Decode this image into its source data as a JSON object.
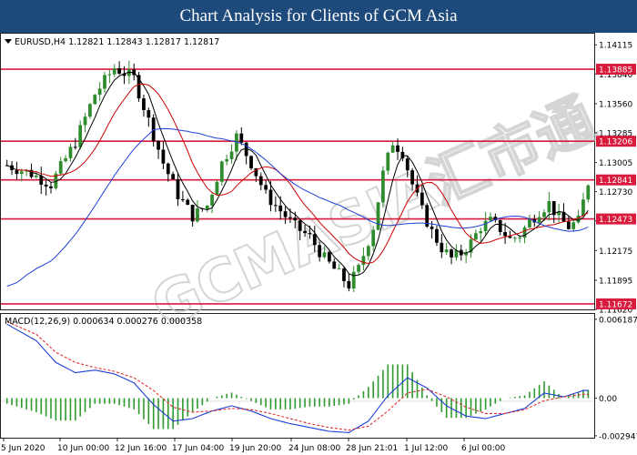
{
  "page_title": "Chart Analysis for Clients of GCM Asia",
  "watermark": "GCMASIA汇市通",
  "colors": {
    "level_line": "#d81b3c",
    "level_label_bg": "#d81b3c",
    "ma_fast": "#000000",
    "ma_medium": "#cc0000",
    "ma_slow": "#1f3fd6",
    "bull_candle": "#2e8b2e",
    "bear_candle": "#000000",
    "macd_hist": "#2e9b2e",
    "macd_line": "#1f3fd6",
    "signal_line": "#e03030",
    "title_bg": "#1d4a7a"
  },
  "chart_data": [
    {
      "type": "candlestick",
      "header": "EURUSD,H4  1.12821 1.12843 1.12817 1.12817",
      "symbol": "EURUSD",
      "timeframe": "H4",
      "ohlc_last": [
        1.12821,
        1.12843,
        1.12817,
        1.12817
      ],
      "ylim": [
        1.1162,
        1.1422
      ],
      "y_ticks": [
        "1.14115",
        "1.13840",
        "1.13560",
        "1.13285",
        "1.13005",
        "1.12730",
        "1.12455",
        "1.12175",
        "1.11895",
        "1.11620"
      ],
      "y_tick_values": [
        1.14115,
        1.1384,
        1.1356,
        1.13285,
        1.13005,
        1.1273,
        1.12455,
        1.12175,
        1.11895,
        1.1162
      ],
      "x_ticks": [
        "5 Jun 2020",
        "10 Jun 00:00",
        "12 Jun 16:00",
        "17 Jun 04:00",
        "19 Jun 20:00",
        "24 Jun 08:00",
        "28 Jun 21:01",
        "1 Jul 12:00",
        "6 Jul 00:00"
      ],
      "levels": [
        {
          "label": "1.13885",
          "value": 1.13885
        },
        {
          "label": "1.13206",
          "value": 1.13206
        },
        {
          "label": "1.12841",
          "value": 1.12841
        },
        {
          "label": "1.12473",
          "value": 1.12473
        },
        {
          "label": "1.11672",
          "value": 1.11672
        }
      ],
      "price_path": [
        [
          0,
          1.1298
        ],
        [
          5,
          1.129
        ],
        [
          9,
          1.128
        ],
        [
          14,
          1.132
        ],
        [
          18,
          1.1365
        ],
        [
          22,
          1.139
        ],
        [
          26,
          1.138
        ],
        [
          29,
          1.134
        ],
        [
          32,
          1.13
        ],
        [
          35,
          1.127
        ],
        [
          38,
          1.125
        ],
        [
          41,
          1.126
        ],
        [
          44,
          1.13
        ],
        [
          47,
          1.1325
        ],
        [
          50,
          1.13
        ],
        [
          53,
          1.127
        ],
        [
          56,
          1.1255
        ],
        [
          59,
          1.124
        ],
        [
          62,
          1.123
        ],
        [
          65,
          1.121
        ],
        [
          68,
          1.1195
        ],
        [
          70,
          1.1185
        ],
        [
          72,
          1.12
        ],
        [
          75,
          1.124
        ],
        [
          77,
          1.129
        ],
        [
          79,
          1.132
        ],
        [
          81,
          1.131
        ],
        [
          83,
          1.128
        ],
        [
          85,
          1.1255
        ],
        [
          87,
          1.1235
        ],
        [
          89,
          1.122
        ],
        [
          91,
          1.121
        ],
        [
          93,
          1.1215
        ],
        [
          95,
          1.1225
        ],
        [
          97,
          1.124
        ],
        [
          99,
          1.1245
        ],
        [
          101,
          1.1238
        ],
        [
          103,
          1.1228
        ],
        [
          105,
          1.1232
        ],
        [
          107,
          1.1245
        ],
        [
          109,
          1.1255
        ],
        [
          111,
          1.1262
        ],
        [
          113,
          1.1248
        ],
        [
          115,
          1.124
        ],
        [
          117,
          1.1245
        ],
        [
          119,
          1.1282
        ]
      ],
      "sub_chart": {
        "header": "MACD(12,26,9) 0.000634 0.000276 0.000358",
        "y_ticks": [
          "0.006187",
          "0.00",
          "-0.002947"
        ],
        "y_tick_values": [
          0.006187,
          0.0,
          -0.002947
        ],
        "ylim": [
          -0.0031,
          0.0066
        ],
        "macd": [
          [
            0,
            0.0058
          ],
          [
            6,
            0.0045
          ],
          [
            10,
            0.0028
          ],
          [
            14,
            0.002
          ],
          [
            18,
            0.0022
          ],
          [
            22,
            0.0019
          ],
          [
            26,
            0.0012
          ],
          [
            30,
            -0.0005
          ],
          [
            34,
            -0.0018
          ],
          [
            38,
            -0.0016
          ],
          [
            42,
            -0.001
          ],
          [
            46,
            -0.0006
          ],
          [
            50,
            -0.001
          ],
          [
            54,
            -0.0016
          ],
          [
            58,
            -0.002
          ],
          [
            62,
            -0.0023
          ],
          [
            66,
            -0.0026
          ],
          [
            70,
            -0.0027
          ],
          [
            74,
            -0.0018
          ],
          [
            78,
            0.0002
          ],
          [
            82,
            0.0016
          ],
          [
            86,
            0.0008
          ],
          [
            90,
            -0.0006
          ],
          [
            94,
            -0.0014
          ],
          [
            98,
            -0.0016
          ],
          [
            102,
            -0.0012
          ],
          [
            106,
            -0.0008
          ],
          [
            110,
            0.0004
          ],
          [
            114,
            0.0001
          ],
          [
            118,
            0.0006
          ]
        ],
        "signal": [
          [
            0,
            0.006
          ],
          [
            6,
            0.005
          ],
          [
            10,
            0.0036
          ],
          [
            14,
            0.0028
          ],
          [
            18,
            0.0024
          ],
          [
            22,
            0.0021
          ],
          [
            26,
            0.0016
          ],
          [
            30,
            0.0006
          ],
          [
            34,
            -0.0007
          ],
          [
            38,
            -0.0011
          ],
          [
            42,
            -0.001
          ],
          [
            46,
            -0.0008
          ],
          [
            50,
            -0.0009
          ],
          [
            54,
            -0.0012
          ],
          [
            58,
            -0.0016
          ],
          [
            62,
            -0.002
          ],
          [
            66,
            -0.0023
          ],
          [
            70,
            -0.0025
          ],
          [
            74,
            -0.0022
          ],
          [
            78,
            -0.001
          ],
          [
            82,
            0.0004
          ],
          [
            86,
            0.0007
          ],
          [
            90,
            0.0001
          ],
          [
            94,
            -0.0007
          ],
          [
            98,
            -0.0012
          ],
          [
            102,
            -0.0012
          ],
          [
            106,
            -0.0009
          ],
          [
            110,
            -0.0002
          ],
          [
            114,
            0.0001
          ],
          [
            118,
            0.0003
          ]
        ]
      }
    }
  ]
}
